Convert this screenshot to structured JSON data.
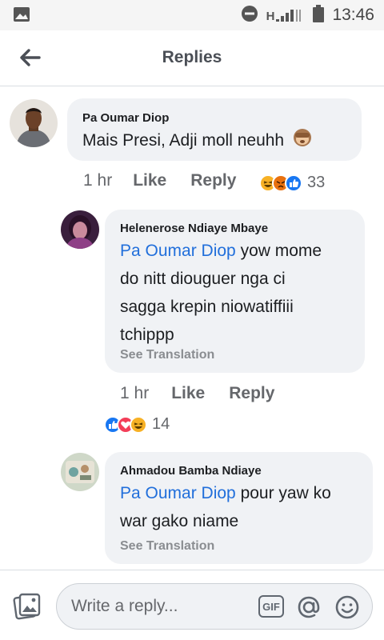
{
  "status_bar": {
    "network": "H",
    "time": "13:46"
  },
  "header": {
    "title": "Replies"
  },
  "comments": [
    {
      "author": "Pa Oumar Diop",
      "text": "Mais Presi, Adji moll neuhh",
      "time": "1 hr",
      "like_label": "Like",
      "reply_label": "Reply",
      "reactions": [
        "haha",
        "angry",
        "like"
      ],
      "reaction_count": "33"
    },
    {
      "author": "Helenerose Ndiaye Mbaye",
      "mention": "Pa Oumar Diop",
      "text_line1": " yow mome",
      "text_line2": "do nitt diouguer nga ci",
      "text_line3": "sagga krepin niowatiffiii",
      "text_line4": "tchippp",
      "see_translation": "See Translation",
      "time": "1 hr",
      "like_label": "Like",
      "reply_label": "Reply",
      "reactions": [
        "like",
        "love",
        "haha"
      ],
      "reaction_count": "14"
    },
    {
      "author": "Ahmadou Bamba Ndiaye",
      "mention": "Pa Oumar Diop",
      "text_line1": " pour yaw ko",
      "text_line2": "war gako niame",
      "see_translation": "See Translation"
    }
  ],
  "composer": {
    "placeholder": "Write a reply...",
    "gif_label": "GIF"
  },
  "colors": {
    "mention": "#216fdb",
    "bubble": "#f0f2f5",
    "like": "#1877f2",
    "love": "#f33e58",
    "haha": "#f7b125"
  }
}
